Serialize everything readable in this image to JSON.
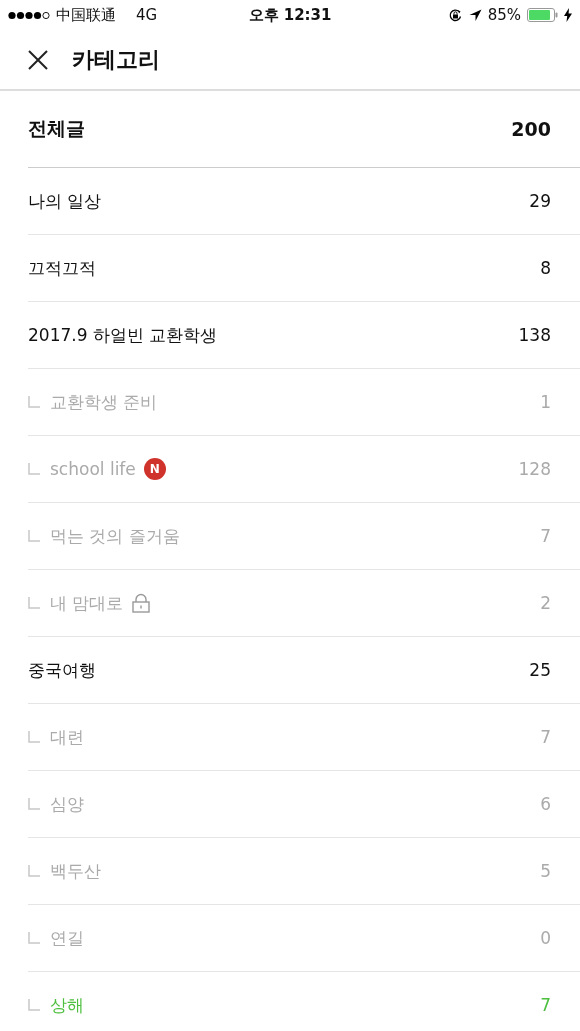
{
  "status_bar": {
    "carrier": "中国联通",
    "network": "4G",
    "time": "오후 12:31",
    "battery": "85%"
  },
  "header": {
    "title": "카테고리"
  },
  "total": {
    "label": "전체글",
    "count": "200"
  },
  "categories": [
    {
      "name": "나의 일상",
      "count": "29",
      "selected": false
    },
    {
      "name": "끄적끄적",
      "count": "8",
      "selected": false
    },
    {
      "name": "2017.9 하얼빈 교환학생",
      "count": "138",
      "selected": false,
      "children": [
        {
          "name": "교환학생 준비",
          "count": "1",
          "selected": false
        },
        {
          "name": "school life",
          "count": "128",
          "selected": false,
          "badge": "N"
        },
        {
          "name": "먹는 것의 즐거움",
          "count": "7",
          "selected": false
        },
        {
          "name": "내 맘대로",
          "count": "2",
          "selected": false,
          "locked": true
        }
      ]
    },
    {
      "name": "중국여행",
      "count": "25",
      "selected": false,
      "children": [
        {
          "name": "대련",
          "count": "7",
          "selected": false
        },
        {
          "name": "심양",
          "count": "6",
          "selected": false
        },
        {
          "name": "백두산",
          "count": "5",
          "selected": false
        },
        {
          "name": "연길",
          "count": "0",
          "selected": false
        },
        {
          "name": "상해",
          "count": "7",
          "selected": true
        }
      ]
    }
  ]
}
